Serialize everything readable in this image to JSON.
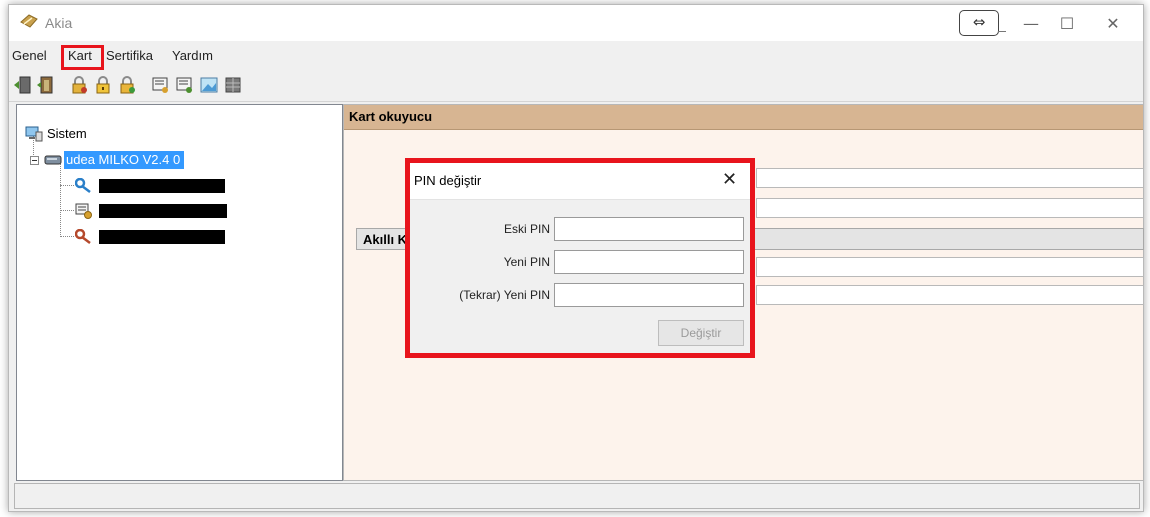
{
  "window": {
    "title": "Akia",
    "controls": {
      "snap": "⇔",
      "minimize": "—",
      "maximize": "☐",
      "close": "✕"
    }
  },
  "menu": {
    "items": [
      "Genel",
      "Kart",
      "Sertifika",
      "Yardım"
    ],
    "highlighted": "Kart"
  },
  "toolbar": {
    "buttons": [
      "exit-icon",
      "open-door-icon",
      "lock-key-icon",
      "lock-yellow-icon",
      "lock-green-icon",
      "certificate-icon",
      "certificate-list-icon",
      "image-icon",
      "grid-icon"
    ]
  },
  "tree": {
    "root": {
      "label": "Sistem",
      "icon": "computer-icon"
    },
    "reader": {
      "label": "udea MILKO V2.4 0",
      "icon": "card-reader-icon"
    },
    "children": [
      {
        "icon": "key-blue-icon"
      },
      {
        "icon": "certificate-icon"
      },
      {
        "icon": "key-red-icon"
      }
    ]
  },
  "panel": {
    "header": "Kart okuyucu",
    "section": "Akıllı K"
  },
  "dialog": {
    "title": "PIN değiştir",
    "close": "✕",
    "fields": [
      {
        "label": "Eski PIN",
        "value": ""
      },
      {
        "label": "Yeni PIN",
        "value": ""
      },
      {
        "label": "(Tekrar) Yeni PIN",
        "value": ""
      }
    ],
    "submit_label": "Değiştir"
  },
  "colors": {
    "highlight": "#e8141c",
    "panel_header": "#d7b592",
    "panel_bg": "#fdf3ec",
    "tree_selection": "#3399ff"
  }
}
